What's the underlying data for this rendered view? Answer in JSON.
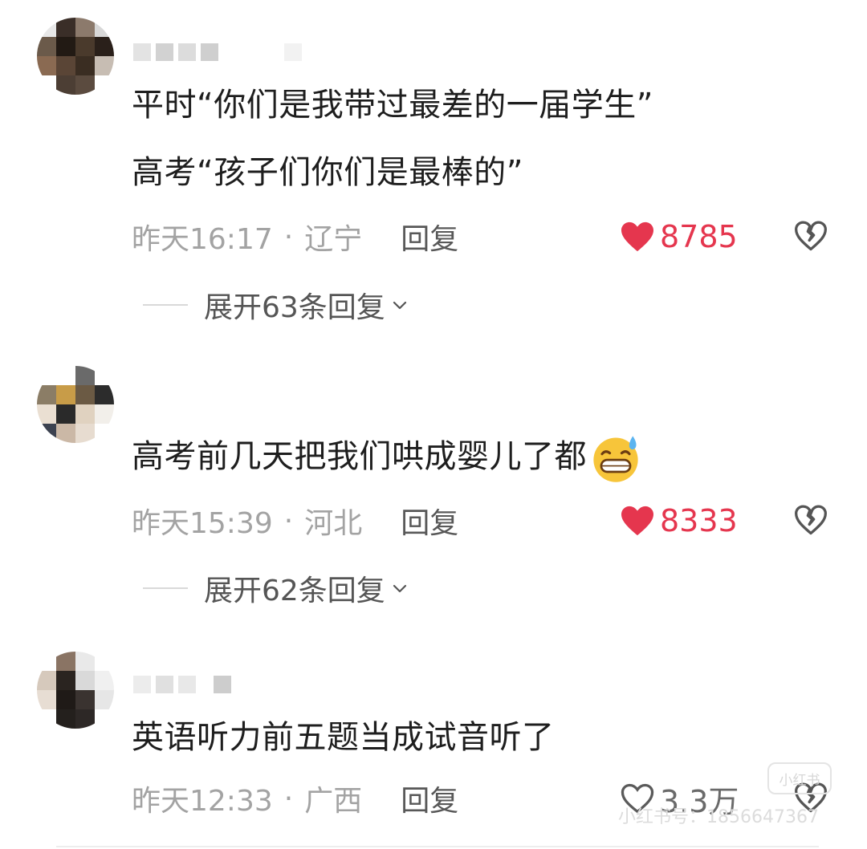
{
  "comments": [
    {
      "text_lines": [
        "平时“你们是我带过最差的一届学生”",
        "高考“孩子们你们是最棒的”"
      ],
      "time": "昨天16:17",
      "location": "辽宁",
      "reply_label": "回复",
      "likes": "8785",
      "liked": true,
      "expand_label": "展开63条回复"
    },
    {
      "text_lines": [
        "高考前几天把我们哄成婴儿了都"
      ],
      "time": "昨天15:39",
      "location": "河北",
      "reply_label": "回复",
      "likes": "8333",
      "liked": true,
      "expand_label": "展开62条回复"
    },
    {
      "text_lines": [
        "英语听力前五题当成试音听了"
      ],
      "time": "昨天12:33",
      "location": "广西",
      "reply_label": "回复",
      "likes": "3.3万",
      "liked": false
    }
  ],
  "separator": "·",
  "icons": {
    "like": "heart-icon",
    "dislike": "broken-heart-icon",
    "expand": "chevron-down-icon",
    "emoji": "sweat-grin-emoji"
  },
  "colors": {
    "liked": "#e5364e",
    "meta": "#a3a3a3",
    "text": "#1e1e1e"
  },
  "watermark": {
    "logo": "小红书",
    "id": "小红书号：1856647367"
  }
}
